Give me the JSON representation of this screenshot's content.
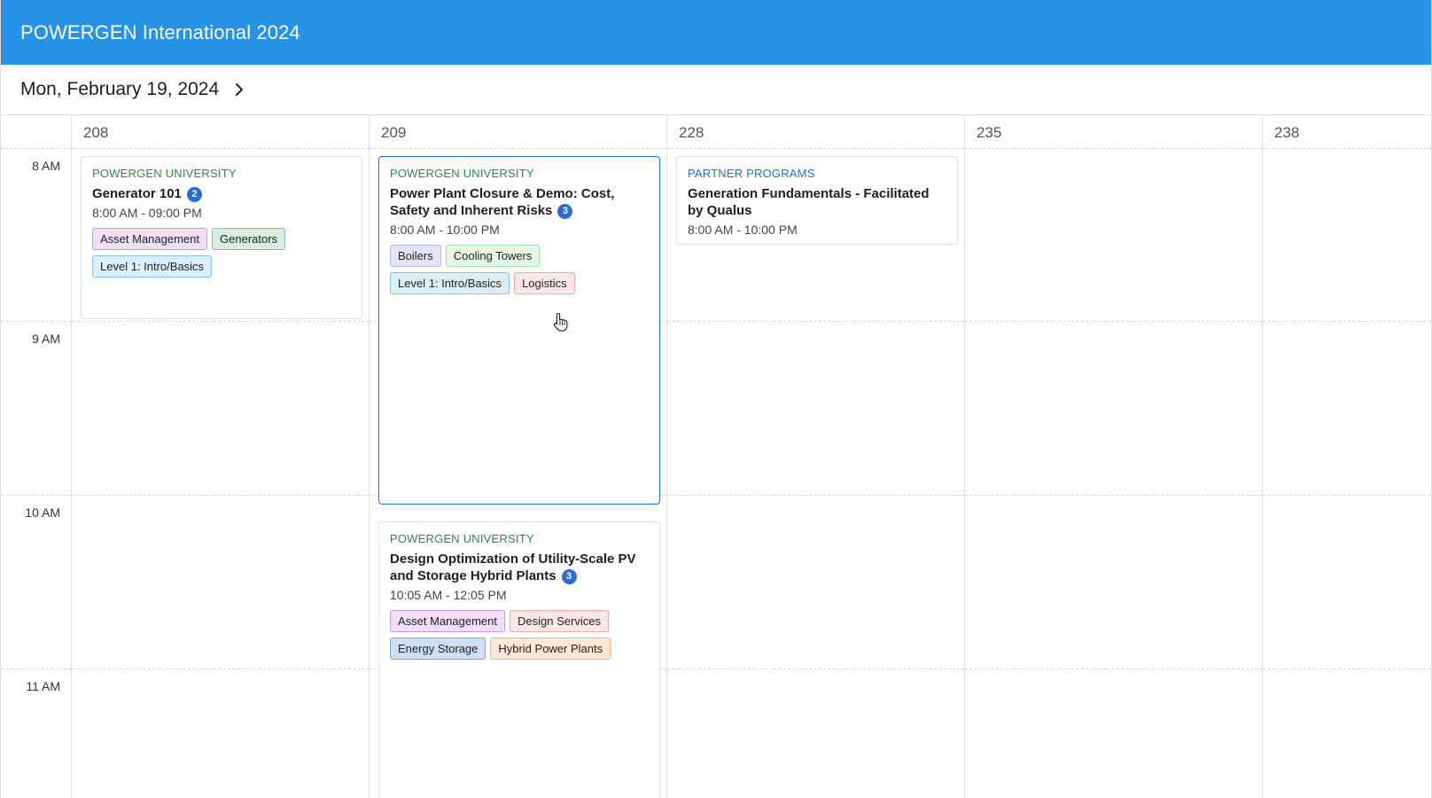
{
  "header": {
    "title": "POWERGEN International 2024"
  },
  "datebar": {
    "date": "Mon, February 19, 2024",
    "next_icon": "chevron-right-icon"
  },
  "time_slots": [
    "8 AM",
    "9 AM",
    "10 AM",
    "11 AM"
  ],
  "rooms": [
    "208",
    "209",
    "228",
    "235",
    "238"
  ],
  "events": [
    {
      "category": "POWERGEN UNIVERSITY",
      "title": "Generator 101",
      "badge": "2",
      "time": "8:00 AM - 09:00 PM",
      "tags": [
        "Asset Management",
        "Generators",
        "Level 1: Intro/Basics"
      ]
    },
    {
      "category": "POWERGEN UNIVERSITY",
      "title": "Power Plant Closure & Demo: Cost, Safety and Inherent Risks",
      "badge": "3",
      "time": "8:00 AM - 10:00 PM",
      "tags": [
        "Boilers",
        "Cooling Towers",
        "Level 1: Intro/Basics",
        "Logistics"
      ]
    },
    {
      "category": "PARTNER PROGRAMS",
      "title": "Generation Fundamentals - Facilitated by Qualus",
      "time": "8:00 AM - 10:00 PM"
    },
    {
      "category": "POWERGEN UNIVERSITY",
      "title": "Design Optimization of Utility-Scale PV and Storage Hybrid Plants",
      "badge": "3",
      "time": "10:05 AM - 12:05 PM",
      "tags": [
        "Asset Management",
        "Design Services",
        "Energy Storage",
        "Hybrid Power Plants"
      ]
    }
  ],
  "colors": {
    "header_bg": "#2793e6",
    "category_green": "#2d8a4e",
    "category_blue": "#1f6fde",
    "badge_bg": "#2c6bd6",
    "selected_border": "#1f6fde"
  }
}
